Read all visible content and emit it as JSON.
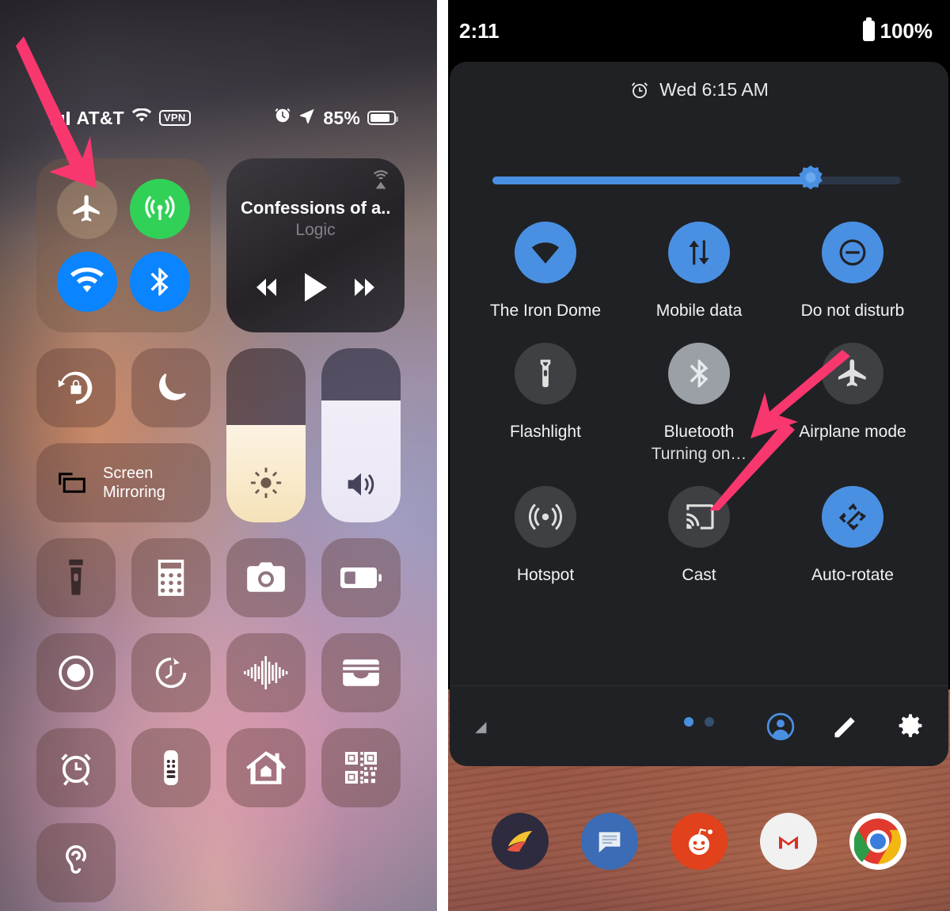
{
  "ios": {
    "status_bar": {
      "carrier": "AT&T",
      "vpn_badge": "VPN",
      "battery_percent": "85%",
      "signal_icon": "cellular-signal-icon",
      "wifi_icon": "wifi-icon",
      "alarm_icon": "alarm-clock-icon",
      "location_icon": "location-arrow-icon",
      "battery_icon": "battery-icon"
    },
    "connectivity": {
      "airplane": {
        "label": "Airplane Mode",
        "state": "off",
        "icon": "airplane-icon"
      },
      "cellular": {
        "label": "Cellular Data",
        "state": "on",
        "icon": "cellular-antenna-icon",
        "color": "#31d158"
      },
      "wifi": {
        "label": "Wi-Fi",
        "state": "on",
        "icon": "wifi-icon",
        "color": "#0a84ff"
      },
      "bluetooth": {
        "label": "Bluetooth",
        "state": "on",
        "icon": "bluetooth-icon",
        "color": "#0a84ff"
      }
    },
    "media": {
      "title": "Confessions of a...",
      "artist": "Logic",
      "airplay_icon": "airplay-audio-icon",
      "rewind_icon": "rewind-icon",
      "play_icon": "play-icon",
      "forward_icon": "fast-forward-icon"
    },
    "tiles": {
      "rotation_lock": {
        "label": "Rotation Lock",
        "icon": "rotation-lock-icon"
      },
      "focus": {
        "label": "Do Not Disturb",
        "icon": "moon-icon"
      },
      "screen_mirroring": {
        "label": "Screen\nMirroring",
        "label_line1": "Screen",
        "label_line2": "Mirroring",
        "icon": "screen-mirroring-icon"
      },
      "brightness": {
        "label": "Brightness",
        "icon": "brightness-sun-icon",
        "level": 56
      },
      "volume": {
        "label": "Volume",
        "icon": "volume-speaker-icon",
        "level": 70
      },
      "flashlight": {
        "label": "Flashlight",
        "icon": "flashlight-icon"
      },
      "calculator": {
        "label": "Calculator",
        "icon": "calculator-icon"
      },
      "camera": {
        "label": "Camera",
        "icon": "camera-icon"
      },
      "low_power": {
        "label": "Low Power Mode",
        "icon": "low-power-battery-icon"
      },
      "screen_record": {
        "label": "Screen Recording",
        "icon": "screen-record-icon"
      },
      "timer": {
        "label": "Timer",
        "icon": "timer-icon"
      },
      "sound_recognition": {
        "label": "Sound Recognition",
        "icon": "sound-waveform-icon"
      },
      "wallet": {
        "label": "Wallet",
        "icon": "wallet-icon"
      },
      "alarm": {
        "label": "Alarm",
        "icon": "alarm-clock-icon"
      },
      "remote": {
        "label": "Apple TV Remote",
        "icon": "tv-remote-icon"
      },
      "home": {
        "label": "Home",
        "icon": "home-house-icon"
      },
      "qr": {
        "label": "Code Scanner",
        "icon": "qr-code-icon"
      },
      "hearing": {
        "label": "Hearing",
        "icon": "ear-hearing-icon"
      }
    },
    "annotation": {
      "arrow_icon": "pink-arrow-down-icon",
      "arrow_color": "#f8376e",
      "points_to": "Airplane Mode"
    }
  },
  "android": {
    "status_bar": {
      "time": "2:11",
      "battery_percent": "100%",
      "battery_icon": "battery-full-icon"
    },
    "quick_settings": {
      "alarm_text": "Wed 6:15 AM",
      "alarm_icon": "alarm-clock-icon",
      "brightness": {
        "icon": "brightness-slider-icon",
        "level_percent": 78,
        "track_color": "#4a90e2"
      },
      "tiles": [
        {
          "label": "The Iron Dome",
          "sub": "",
          "icon": "wifi-icon",
          "state": "on"
        },
        {
          "label": "Mobile data",
          "sub": "",
          "icon": "mobile-data-arrows-icon",
          "state": "on"
        },
        {
          "label": "Do not disturb",
          "sub": "",
          "icon": "do-not-disturb-icon",
          "state": "on"
        },
        {
          "label": "Flashlight",
          "sub": "",
          "icon": "flashlight-icon",
          "state": "off"
        },
        {
          "label": "Bluetooth",
          "sub": "Turning on…",
          "icon": "bluetooth-icon",
          "state": "transitioning"
        },
        {
          "label": "Airplane mode",
          "sub": "",
          "icon": "airplane-icon",
          "state": "off"
        },
        {
          "label": "Hotspot",
          "sub": "",
          "icon": "hotspot-icon",
          "state": "off"
        },
        {
          "label": "Cast",
          "sub": "",
          "icon": "cast-screen-icon",
          "state": "off"
        },
        {
          "label": "Auto-rotate",
          "sub": "",
          "icon": "auto-rotate-icon",
          "state": "on"
        }
      ],
      "page_dots": {
        "count": 2,
        "active_index": 0
      },
      "footer": {
        "signal_icon": "signal-triangle-icon",
        "user_icon": "user-account-icon",
        "edit_icon": "pencil-edit-icon",
        "settings_icon": "gear-settings-icon"
      }
    },
    "dock": [
      {
        "name": "Pocket Casts",
        "icon": "pocket-casts-app-icon"
      },
      {
        "name": "Messages",
        "icon": "messages-app-icon"
      },
      {
        "name": "Reddit",
        "icon": "reddit-app-icon"
      },
      {
        "name": "Gmail",
        "icon": "gmail-app-icon"
      },
      {
        "name": "Chrome",
        "icon": "chrome-app-icon"
      }
    ],
    "annotation": {
      "arrow_icon": "pink-arrow-up-right-icon",
      "arrow_color": "#f8376e",
      "points_to": "Airplane mode"
    }
  }
}
